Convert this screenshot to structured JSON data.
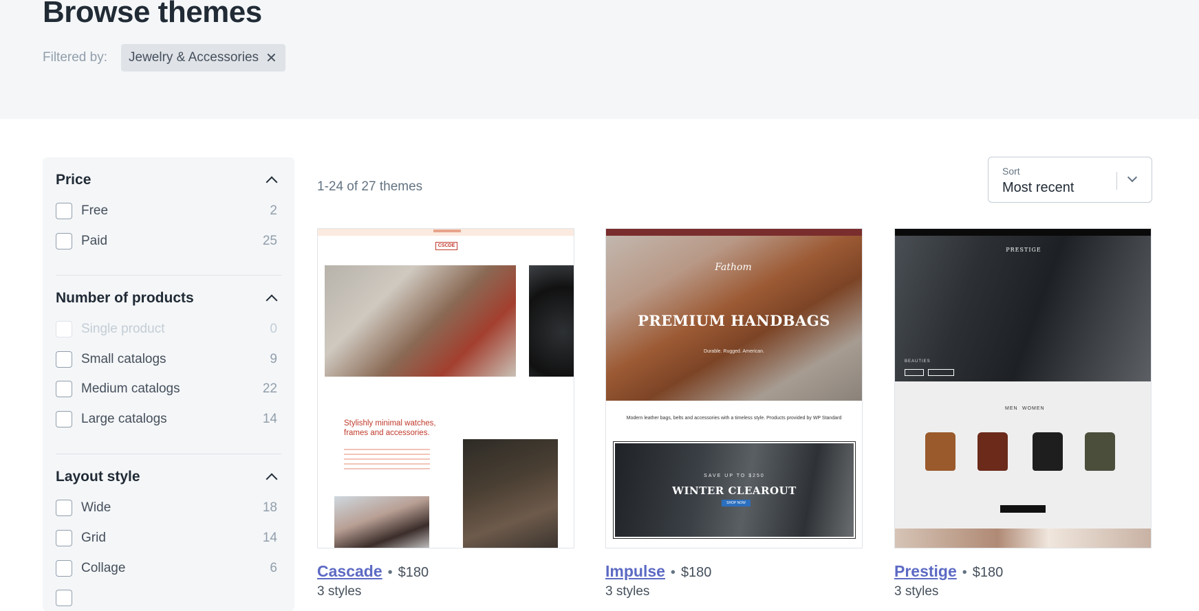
{
  "header": {
    "title": "Browse themes",
    "filtered_by_label": "Filtered by:",
    "active_filter": "Jewelry & Accessories",
    "remove_icon": "close-icon"
  },
  "sidebar": {
    "price": {
      "title": "Price",
      "options": [
        {
          "label": "Free",
          "count": "2"
        },
        {
          "label": "Paid",
          "count": "25"
        }
      ]
    },
    "number_of_products": {
      "title": "Number of products",
      "options": [
        {
          "label": "Single product",
          "count": "0",
          "disabled": true
        },
        {
          "label": "Small catalogs",
          "count": "9"
        },
        {
          "label": "Medium catalogs",
          "count": "22"
        },
        {
          "label": "Large catalogs",
          "count": "14"
        }
      ]
    },
    "layout_style": {
      "title": "Layout style",
      "options": [
        {
          "label": "Wide",
          "count": "18"
        },
        {
          "label": "Grid",
          "count": "14"
        },
        {
          "label": "Collage",
          "count": "6"
        }
      ]
    }
  },
  "results": {
    "count_text": "1-24 of 27 themes"
  },
  "sort": {
    "label": "Sort",
    "value": "Most recent"
  },
  "themes": [
    {
      "name": "Cascade",
      "price": "$180",
      "styles": "3 styles",
      "preview": {
        "logo": "CSCDE",
        "heading": "Stylishly minimal watches, frames and accessories."
      }
    },
    {
      "name": "Impulse",
      "price": "$180",
      "styles": "3 styles",
      "preview": {
        "logo": "Fathom",
        "headline": "PREMIUM HANDBAGS",
        "subheadline": "Durable. Rugged. American.",
        "description": "Modern leather bags, belts and accessories with a timeless style. Products provided by WP Standard",
        "banner_kicker": "SAVE UP TO $250",
        "banner_title": "WINTER CLEAROUT",
        "banner_button": "SHOP NOW"
      }
    },
    {
      "name": "Prestige",
      "price": "$180",
      "styles": "3 styles",
      "preview": {
        "logo": "PRESTIGE",
        "kicker": "BEAUTIES",
        "tab_men": "MEN",
        "tab_women": "WOMEN"
      }
    }
  ],
  "colors": {
    "link": "#5c6ac4",
    "hero_bg": "#f4f6f8",
    "chip_bg": "#dfe3e8"
  }
}
